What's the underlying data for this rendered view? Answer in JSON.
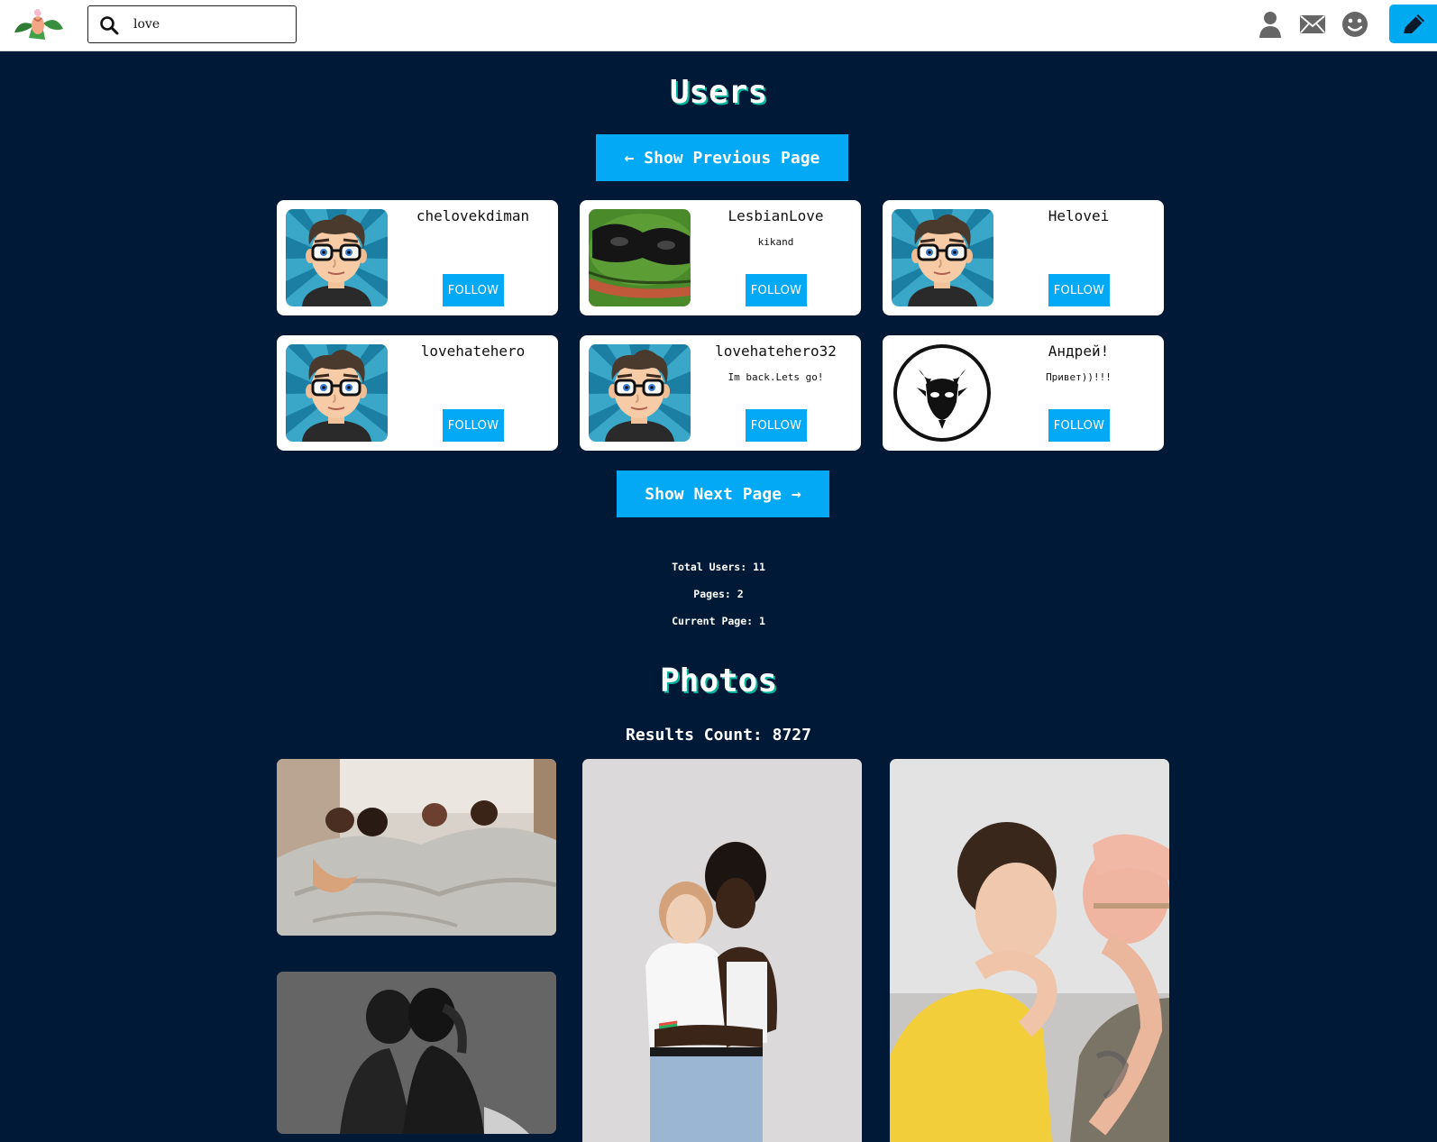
{
  "header": {
    "search_value": "love",
    "icons": [
      "leaf-logo-icon",
      "search-icon",
      "profile-icon",
      "mail-icon",
      "smiley-icon",
      "pencil-icon"
    ],
    "accent": "#00aaf0"
  },
  "users_section": {
    "title": "Users",
    "prev_label": "← Show Previous Page",
    "next_label": "Show Next Page →",
    "follow_label": "FOLLOW",
    "users": [
      {
        "name": "chelovekdiman",
        "bio": "",
        "avatar": "cartoon-man-glasses"
      },
      {
        "name": "LesbianLove",
        "bio": "kikand",
        "avatar": "frog-sunglasses"
      },
      {
        "name": "Helovei",
        "bio": "",
        "avatar": "cartoon-man-glasses"
      },
      {
        "name": "lovehatehero",
        "bio": "",
        "avatar": "cartoon-man-glasses"
      },
      {
        "name": "lovehatehero32",
        "bio": "Im back.Lets go!",
        "avatar": "cartoon-man-glasses"
      },
      {
        "name": "Андрей!",
        "bio": "Привет))!!!",
        "avatar": "goat-head-logo"
      }
    ],
    "stats": {
      "total": "Total Users: 11",
      "pages": "Pages: 2",
      "current": "Current Page: 1"
    }
  },
  "photos_section": {
    "title": "Photos",
    "results": "Results Count: 8727",
    "photos": [
      "couples-in-bed",
      "two-women-embracing",
      "two-men-kissing",
      "two-men-foreheads-bw"
    ]
  },
  "colors": {
    "background": "#001937",
    "button": "#03a9f4",
    "title_shadow": "#00b59b"
  }
}
